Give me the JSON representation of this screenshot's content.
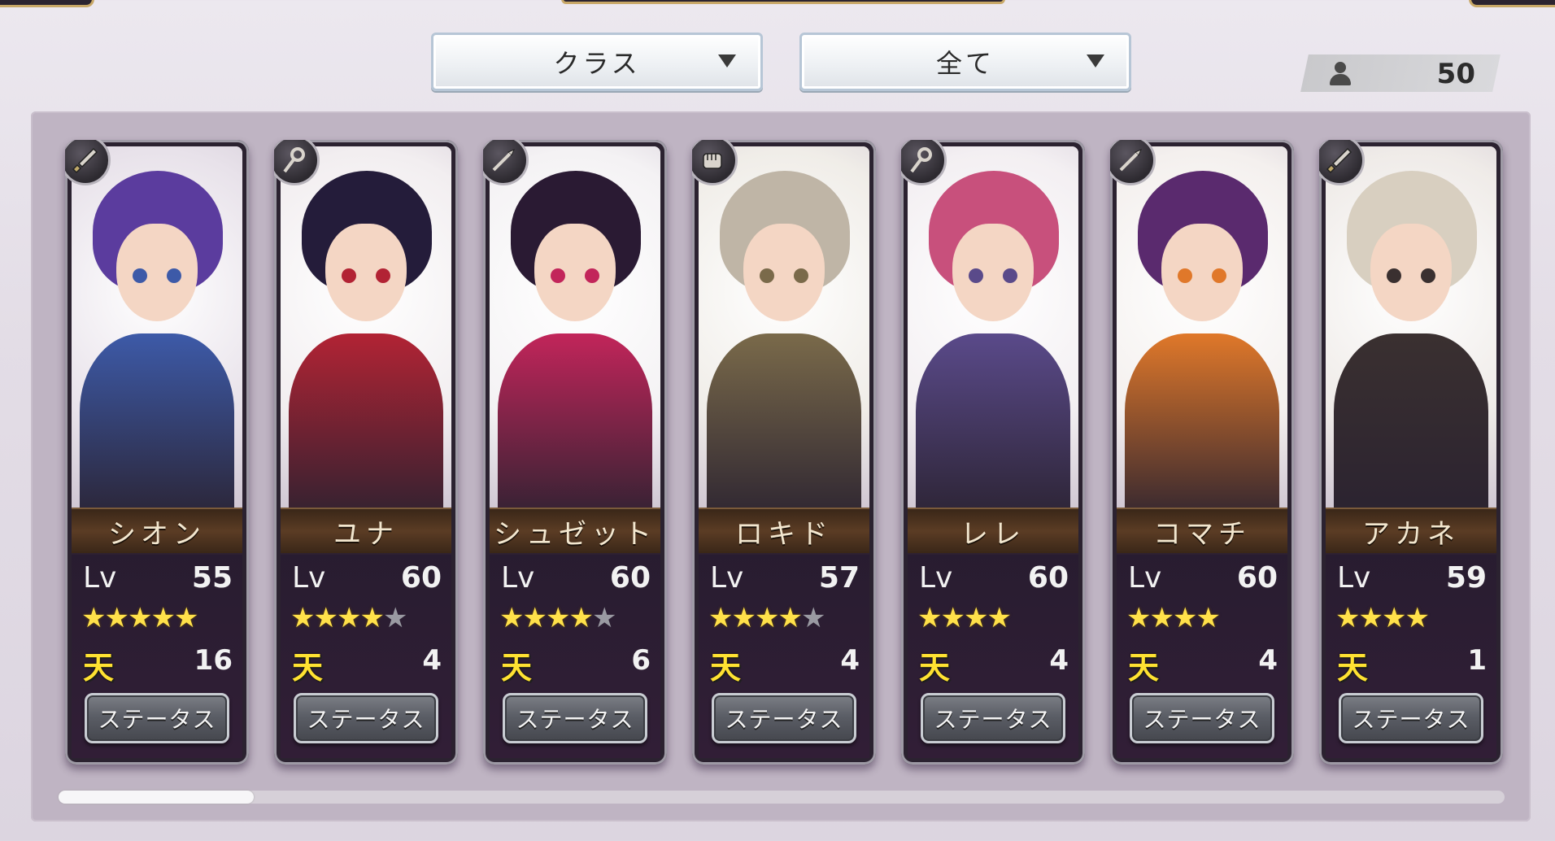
{
  "filters": {
    "class_label": "クラス",
    "type_label": "全て"
  },
  "unit_count": "50",
  "characters": [
    {
      "name": "シオン",
      "lv_label": "Lv",
      "level": "55",
      "stars": 5,
      "stars_max": 5,
      "ten_icon": "天",
      "ten_value": "16",
      "status_label": "ステータス",
      "class_icon": "sword-icon",
      "hair": "#5b3c9e",
      "accent": "#3d5aa8",
      "bg": "#e8e2ea"
    },
    {
      "name": "ユナ",
      "lv_label": "Lv",
      "level": "60",
      "stars": 4,
      "stars_max": 5,
      "ten_icon": "天",
      "ten_value": "4",
      "status_label": "ステータス",
      "class_icon": "staff-icon",
      "hair": "#241c3a",
      "accent": "#b22334",
      "bg": "#f2eef0"
    },
    {
      "name": "シュゼット",
      "lv_label": "Lv",
      "level": "60",
      "stars": 4,
      "stars_max": 5,
      "ten_icon": "天",
      "ten_value": "6",
      "status_label": "ステータス",
      "class_icon": "spear-icon",
      "hair": "#2a1a33",
      "accent": "#c2255a",
      "bg": "#f4f2f4"
    },
    {
      "name": "ロキド",
      "lv_label": "Lv",
      "level": "57",
      "stars": 4,
      "stars_max": 5,
      "ten_icon": "天",
      "ten_value": "4",
      "status_label": "ステータス",
      "class_icon": "fist-icon",
      "hair": "#bfb5a6",
      "accent": "#7a6a4a",
      "bg": "#f0ede8"
    },
    {
      "name": "レレ",
      "lv_label": "Lv",
      "level": "60",
      "stars": 4,
      "stars_max": 4,
      "ten_icon": "天",
      "ten_value": "4",
      "status_label": "ステータス",
      "class_icon": "staff-icon",
      "hair": "#c8507c",
      "accent": "#5a4a8a",
      "bg": "#f3eff2"
    },
    {
      "name": "コマチ",
      "lv_label": "Lv",
      "level": "60",
      "stars": 4,
      "stars_max": 4,
      "ten_icon": "天",
      "ten_value": "4",
      "status_label": "ステータス",
      "class_icon": "spear-icon",
      "hair": "#5a2a6e",
      "accent": "#e0782a",
      "bg": "#f4f0ee"
    },
    {
      "name": "アカネ",
      "lv_label": "Lv",
      "level": "59",
      "stars": 4,
      "stars_max": 4,
      "ten_icon": "天",
      "ten_value": "1",
      "status_label": "ステータス",
      "class_icon": "sword-icon",
      "hair": "#d8cfc0",
      "accent": "#3a3030",
      "bg": "#efebe8"
    }
  ],
  "colors": {
    "star_on": "#ffe14a",
    "star_off": "#9a9aa2",
    "ten_icon": "#ffe232",
    "name_bar": "#5b3c24"
  }
}
